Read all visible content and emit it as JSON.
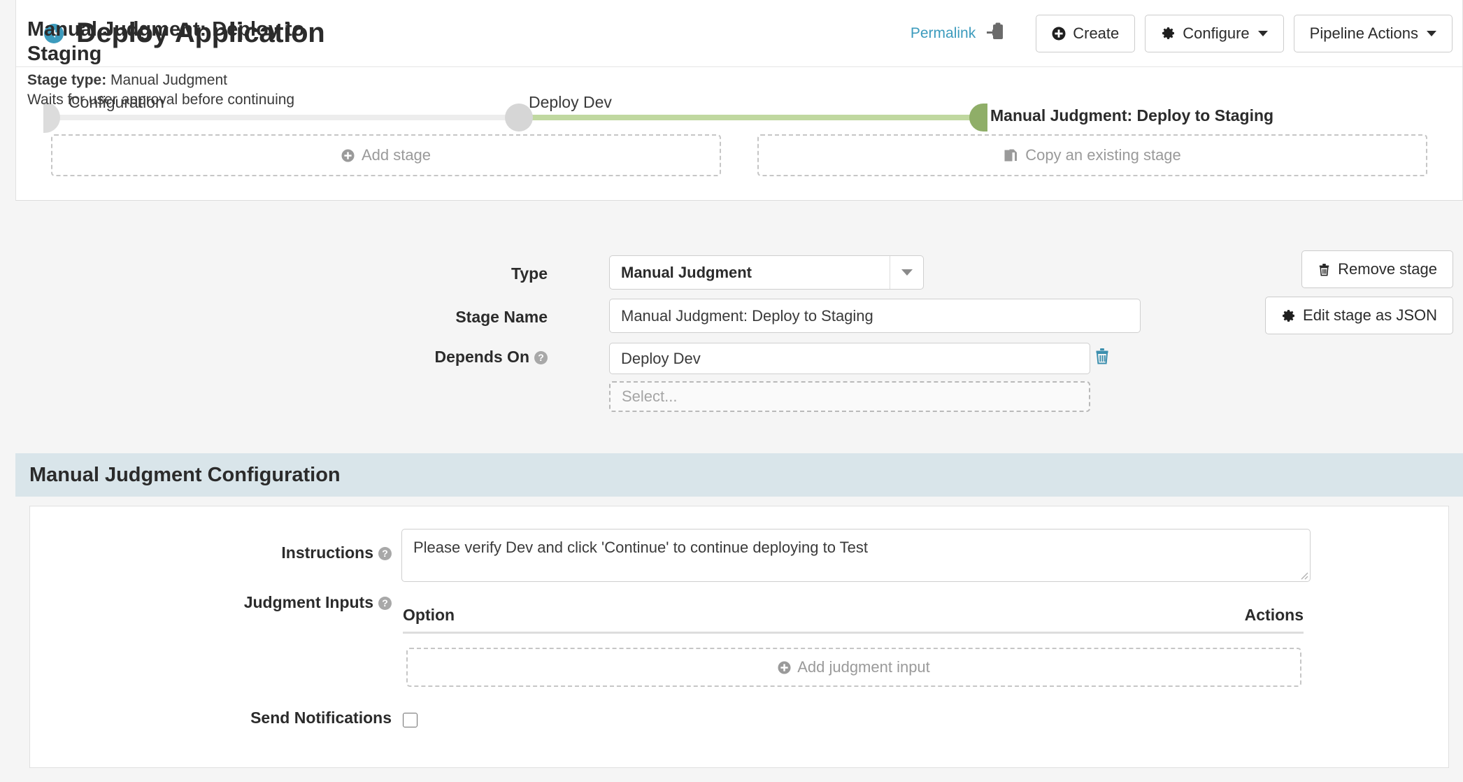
{
  "header": {
    "back_icon": "back-arrow-icon",
    "title": "Deploy Application",
    "permalink_label": "Permalink",
    "clipboard_icon": "copy-to-clipboard-icon",
    "buttons": [
      {
        "label": "Create",
        "icon": "plus-circle-icon",
        "caret": false
      },
      {
        "label": "Configure",
        "icon": "gear-icon",
        "caret": true
      },
      {
        "label": "Pipeline Actions",
        "icon": null,
        "caret": true
      }
    ]
  },
  "pipeline_graph": {
    "stages": [
      {
        "label": "Configuration",
        "state": "inactive",
        "shape": "half-right"
      },
      {
        "label": "Deploy Dev",
        "state": "inactive",
        "shape": "circle"
      },
      {
        "label": "Manual Judgment: Deploy to Staging",
        "state": "selected",
        "shape": "half-left"
      }
    ],
    "add_stage_label": "Add stage",
    "add_stage_icon": "plus-circle-icon",
    "copy_stage_label": "Copy an existing stage",
    "copy_stage_icon": "copy-pages-icon",
    "colors": {
      "track": "#ededed",
      "track_active": "#c0d8a0",
      "node_active": "#8fae68",
      "node_inactive": "#d6d6d6"
    }
  },
  "stage_detail": {
    "title": "Manual Judgment: Deploy to Staging",
    "stage_type_label": "Stage type:",
    "stage_type_value": "Manual Judgment",
    "description": "Waits for user approval before continuing",
    "fields": {
      "type_label": "Type",
      "type_value": "Manual Judgment",
      "stage_name_label": "Stage Name",
      "stage_name_value": "Manual Judgment: Deploy to Staging",
      "depends_on_label": "Depends On",
      "depends_on_value": "Deploy Dev",
      "depends_on_placeholder": "Select...",
      "depends_on_delete_icon": "trash-icon",
      "help_icon": "?"
    },
    "actions": [
      {
        "label": "Remove stage",
        "icon": "trash-icon"
      },
      {
        "label": "Edit stage as JSON",
        "icon": "gear-icon"
      }
    ]
  },
  "configuration": {
    "section_title": "Manual Judgment Configuration",
    "section_bg": "#d9e5ea",
    "instructions_label": "Instructions",
    "instructions_value": "Please verify Dev and click 'Continue' to continue deploying to Test",
    "judgment_inputs_label": "Judgment Inputs",
    "table_headers": [
      "Option",
      "Actions"
    ],
    "table_rows": [],
    "add_judgment_input_label": "Add judgment input",
    "add_judgment_input_icon": "plus-circle-icon",
    "send_notifications_label": "Send Notifications",
    "send_notifications_checked": false
  }
}
